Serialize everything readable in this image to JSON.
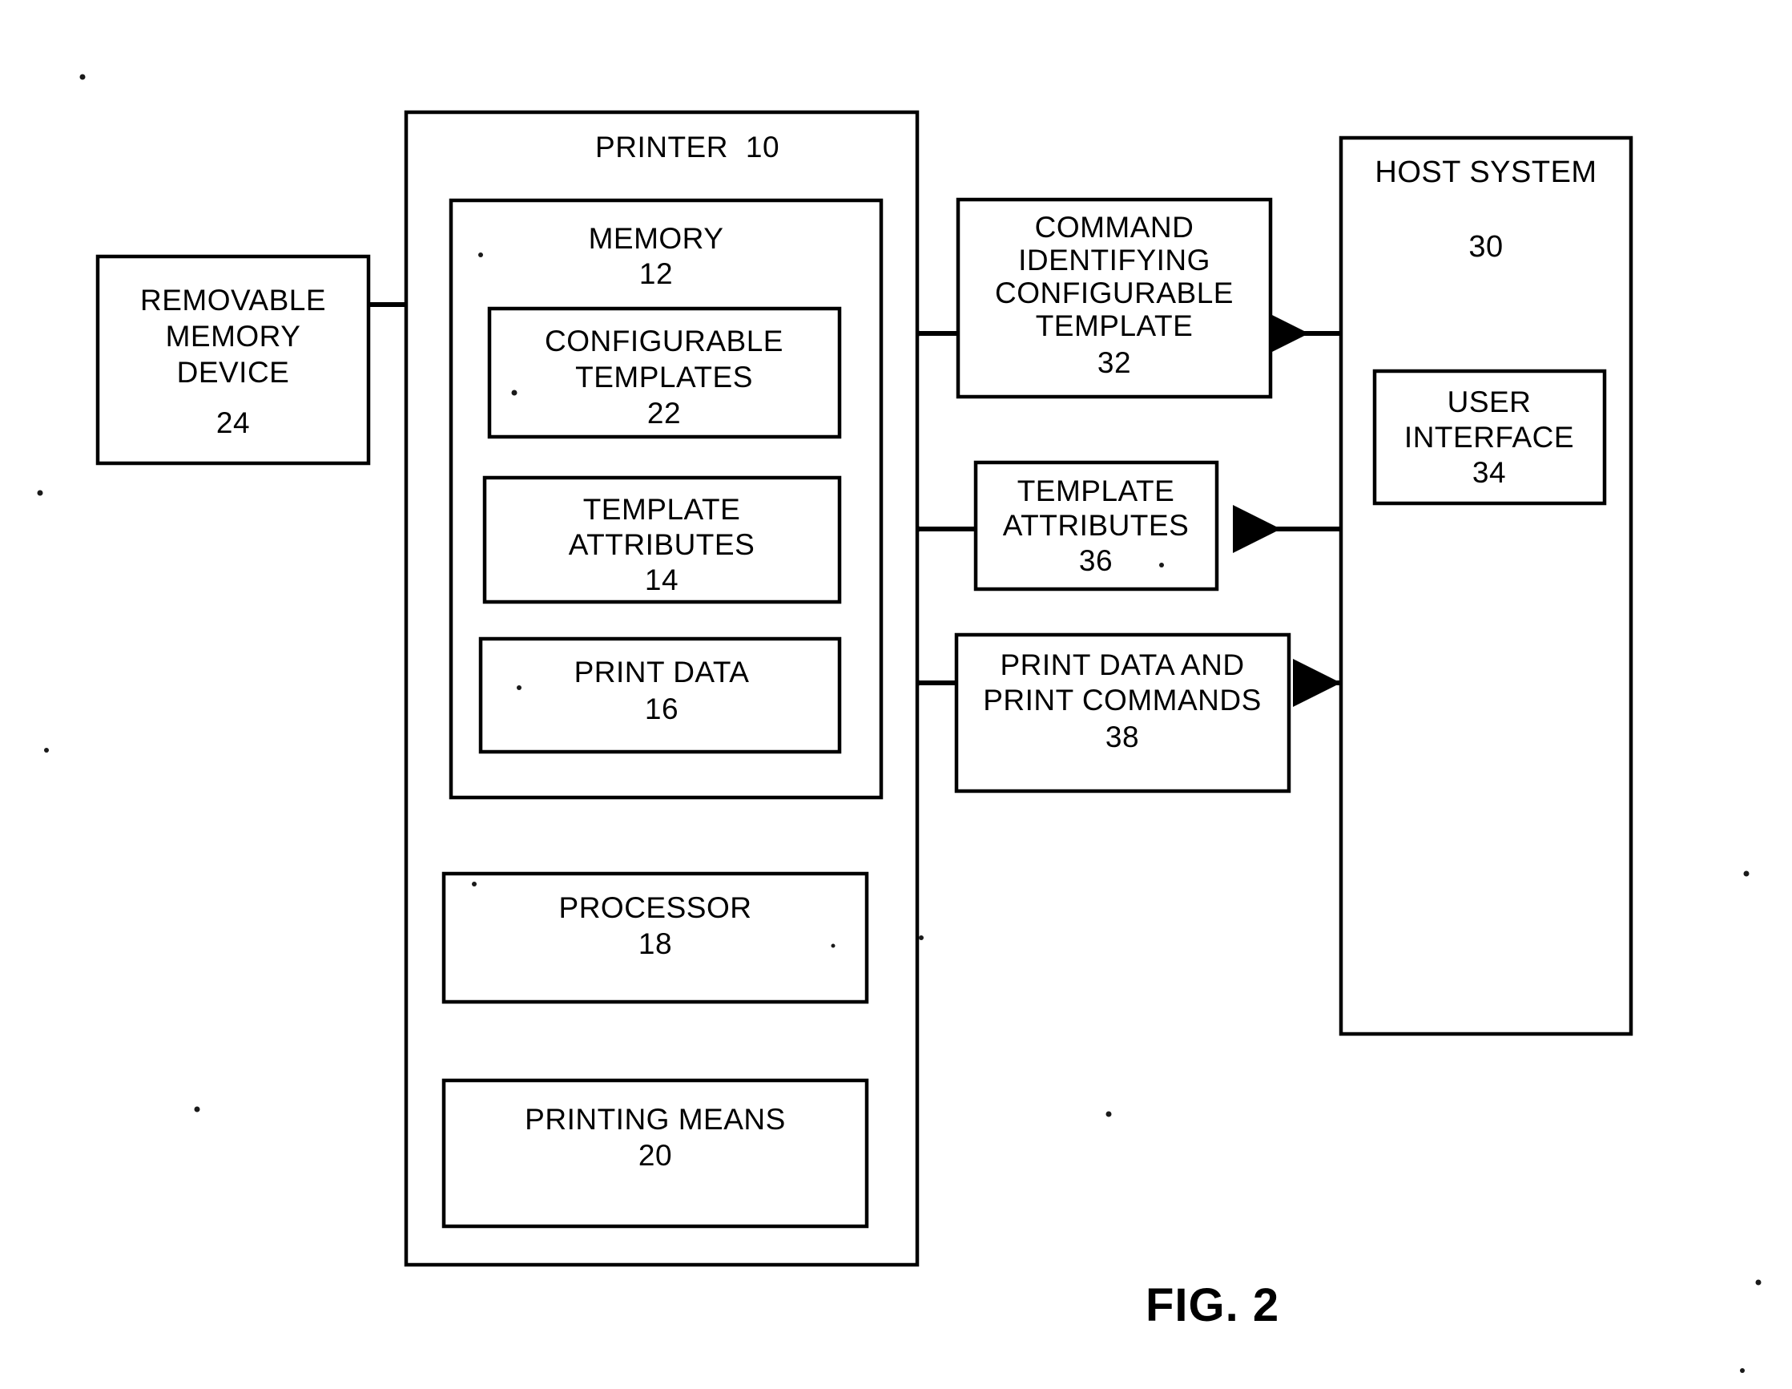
{
  "figure": {
    "caption": "FIG. 2",
    "type": "patent-block-diagram",
    "description": "Printer with configurable templates, host system and removable memory device"
  },
  "nodes": {
    "printer": {
      "id": "printer",
      "title": "PRINTER",
      "ref": "10"
    },
    "memory": {
      "id": "memory",
      "title": "MEMORY",
      "ref": "12"
    },
    "configurable_templates": {
      "id": "configurable_templates",
      "line1": "CONFIGURABLE",
      "line2": "TEMPLATES",
      "ref": "22"
    },
    "template_attributes_mem": {
      "id": "template_attributes_mem",
      "line1": "TEMPLATE",
      "line2": "ATTRIBUTES",
      "ref": "14"
    },
    "print_data_mem": {
      "id": "print_data_mem",
      "line1": "PRINT DATA",
      "ref": "16"
    },
    "processor": {
      "id": "processor",
      "line1": "PROCESSOR",
      "ref": "18"
    },
    "printing_means": {
      "id": "printing_means",
      "line1": "PRINTING MEANS",
      "ref": "20"
    },
    "removable_memory": {
      "id": "removable_memory",
      "line1": "REMOVABLE",
      "line2": "MEMORY",
      "line3": "DEVICE",
      "ref": "24"
    },
    "command_identifying": {
      "id": "command_identifying",
      "line1": "COMMAND",
      "line2": "IDENTIFYING",
      "line3": "CONFIGURABLE",
      "line4": "TEMPLATE",
      "ref": "32"
    },
    "template_attributes_msg": {
      "id": "template_attributes_msg",
      "line1": "TEMPLATE",
      "line2": "ATTRIBUTES",
      "ref": "36"
    },
    "print_data_msg": {
      "id": "print_data_msg",
      "line1": "PRINT DATA AND",
      "line2": "PRINT COMMANDS",
      "ref": "38"
    },
    "host_system": {
      "id": "host_system",
      "title": "HOST SYSTEM",
      "ref": "30"
    },
    "user_interface": {
      "id": "user_interface",
      "line1": "USER",
      "line2": "INTERFACE",
      "ref": "34"
    }
  },
  "edges": [
    {
      "from": "removable_memory",
      "to": "memory",
      "direction": "right"
    },
    {
      "from": "command_identifying",
      "to": "memory",
      "direction": "left"
    },
    {
      "from": "host_system",
      "to": "command_identifying",
      "direction": "left"
    },
    {
      "from": "template_attributes_msg",
      "to": "template_attributes_mem",
      "direction": "left"
    },
    {
      "from": "host_system",
      "to": "template_attributes_msg",
      "direction": "left"
    },
    {
      "from": "print_data_msg",
      "to": "print_data_mem",
      "direction": "left"
    },
    {
      "from": "host_system",
      "to": "print_data_msg",
      "direction": "left"
    },
    {
      "from": "memory",
      "to": "processor",
      "direction": "down"
    },
    {
      "from": "processor",
      "to": "printing_means",
      "direction": "down"
    }
  ],
  "colors": {
    "stroke": "#000000",
    "fill": "#ffffff",
    "background": "#ffffff"
  }
}
